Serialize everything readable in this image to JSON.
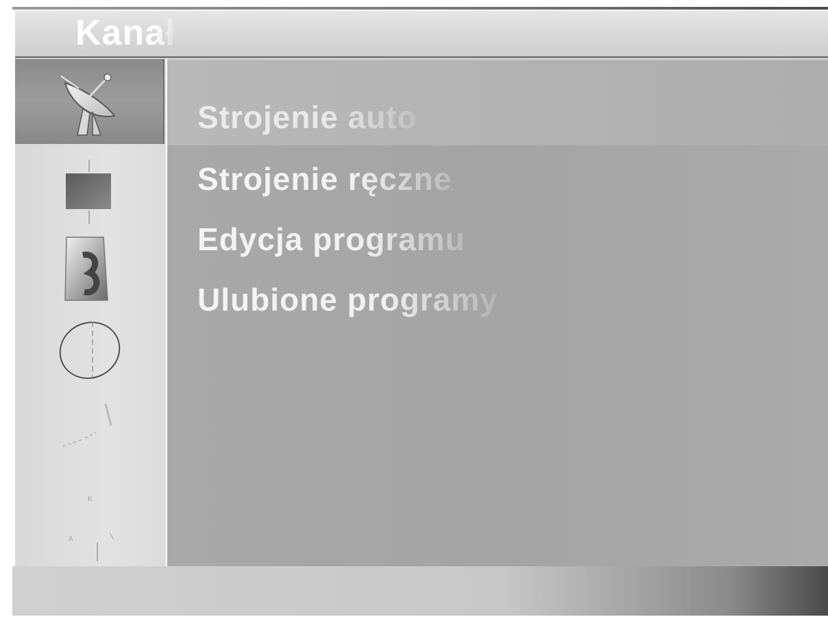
{
  "header": {
    "title": "Kanał"
  },
  "sidebar": {
    "items": [
      {
        "icon": "satellite-dish-icon",
        "active": true
      },
      {
        "icon": "picture-icon",
        "active": false
      },
      {
        "icon": "audio-icon",
        "active": false
      },
      {
        "icon": "clock-icon",
        "active": false
      },
      {
        "icon": "special-icon",
        "active": false
      },
      {
        "icon": "screen-icon",
        "active": false
      }
    ]
  },
  "menu": {
    "items": [
      {
        "label": "Strojenie auto"
      },
      {
        "label": "Strojenie ręczne"
      },
      {
        "label": "Edycja programu"
      },
      {
        "label": "Ulubione programy"
      }
    ],
    "selected_index": 0
  },
  "colors": {
    "content_bg": "#a8a8a8",
    "sidebar_bg": "#dcdcdc",
    "active_tab": "#8a8a8a",
    "text": "#f0f0f0"
  }
}
